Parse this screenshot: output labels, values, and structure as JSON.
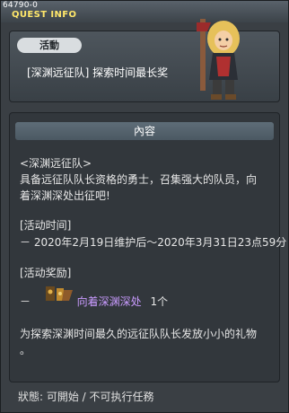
{
  "window": {
    "quest_id": "64790-0",
    "title": "QUEST INFO"
  },
  "header": {
    "badge": "活動",
    "text": "[深渊远征队] 探索时间最长奖"
  },
  "content": {
    "section_title": "內容",
    "lines": {
      "l1": "<深渊远征队>",
      "l2": "具备远征队队长资格的勇士，召集强大的队员，向",
      "l3": "着深渊深处出征吧!",
      "l4": "[活动时间]",
      "l5": "－ 2020年2月19日维护后～2020年3月31日23点59分",
      "l6": "[活动奖励]",
      "l7_dash": "－",
      "l7_item": "向着深渊深处",
      "l7_count": "1个",
      "l8": "为探索深渊时间最久的远征队队长发放小小的礼物",
      "l9": "。"
    }
  },
  "status": {
    "text": "狀態: 可開始 / 不可执行任務"
  },
  "colors": {
    "title_yellow": "#ffe76a",
    "reward_purple": "#c99bff"
  },
  "icons": {
    "npc": "npc-portrait-icon",
    "reward": "reward-item-icon"
  }
}
